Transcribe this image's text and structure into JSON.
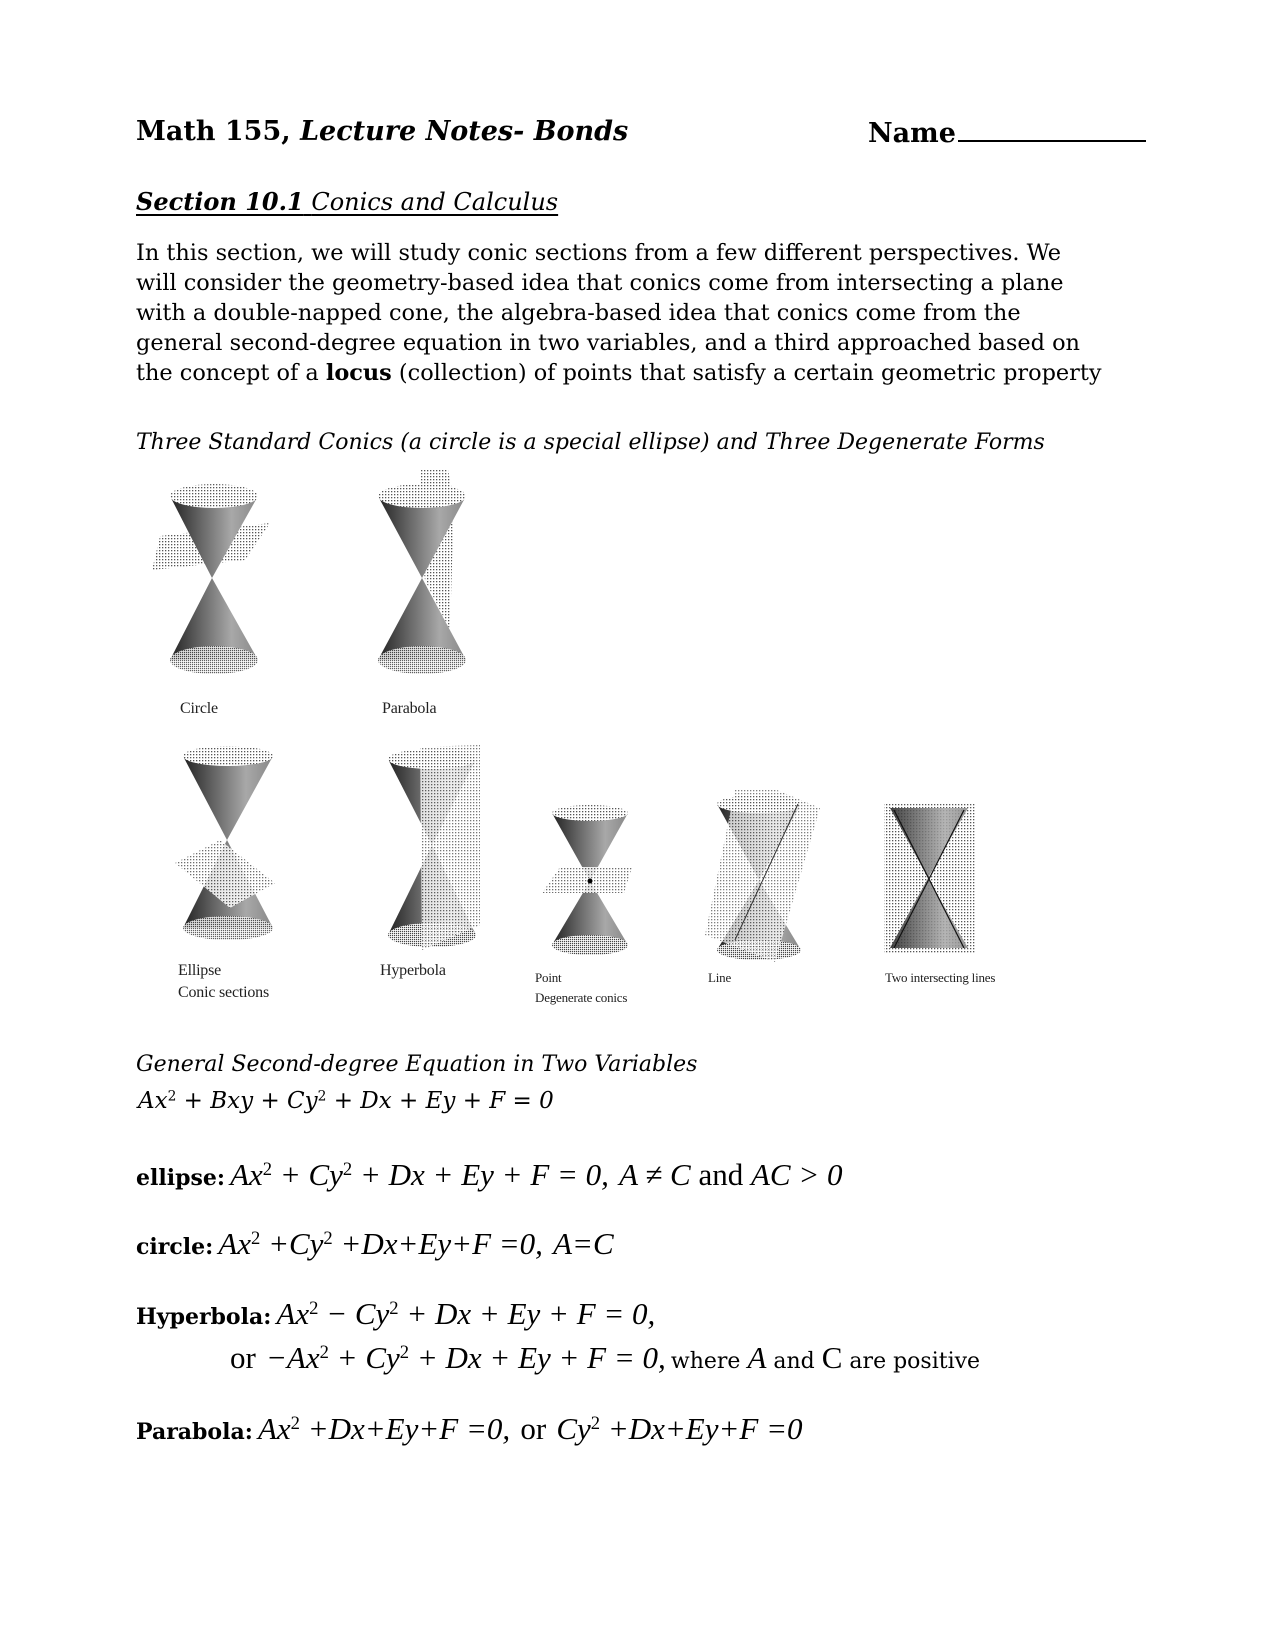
{
  "header": {
    "course": "Math 155,",
    "doc_title": "Lecture Notes- Bonds",
    "name_label": "Name"
  },
  "section": {
    "number": "Section 10.1",
    "title": "Conics and Calculus"
  },
  "intro": {
    "lines": [
      "In this section, we will study conic sections from a few different perspectives. We",
      "will consider the geometry-based idea that conics come from intersecting a plane",
      "with a double-napped cone, the algebra-based idea that conics come from the",
      "general second-degree equation in two variables, and a third approached based on"
    ],
    "last_line_before": "the concept of a ",
    "last_line_bold": "locus",
    "last_line_after": " (collection) of points that satisfy a certain geometric property"
  },
  "figure": {
    "caption": "Three Standard Conics (a circle is a special ellipse) and Three Degenerate Forms",
    "top_row": [
      {
        "label": "Circle",
        "plane": "horizontal"
      },
      {
        "label": "Parabola",
        "plane": "parallel-to-side"
      }
    ],
    "bottom_row": [
      {
        "label": "Ellipse",
        "sublabel": "Conic sections",
        "plane": "tilted"
      },
      {
        "label": "Hyperbola",
        "plane": "vertical"
      },
      {
        "label": "Point",
        "sublabel": "Degenerate conics",
        "plane": "through-vertex-horizontal"
      },
      {
        "label": "Line",
        "plane": "tangent-through-vertex"
      },
      {
        "label": "Two intersecting lines",
        "plane": "vertical-through-vertex"
      }
    ]
  },
  "general": {
    "heading": "General Second-degree Equation in Two Variables",
    "equation_parts": [
      "Ax",
      "2",
      " + Bxy + Cy",
      "2",
      " + Dx + Ey + F = 0"
    ]
  },
  "forms": {
    "ellipse": {
      "label": "ellipse:",
      "eq_a": "Ax",
      "sup1": "2",
      "eq_b": " + Cy",
      "sup2": "2",
      "eq_c": " + Dx + Ey + F = 0,",
      "cond_a": "A ≠ C",
      "cond_and": " and ",
      "cond_b": "AC > 0"
    },
    "circle": {
      "label": "circle:",
      "eq_a": "Ax",
      "sup1": "2",
      "eq_b": " +Cy",
      "sup2": "2",
      "eq_c": " +Dx+Ey+F =0,",
      "cond": "A=C"
    },
    "hyperbola": {
      "label": "Hyperbola:",
      "eq1_a": "Ax",
      "sup1": "2",
      "eq1_b": " − Cy",
      "sup2": "2",
      "eq1_c": " + Dx + Ey + F = 0,",
      "or": "or",
      "eq2_a": "−Ax",
      "sup3": "2",
      "eq2_b": " + Cy",
      "sup4": "2",
      "eq2_c": " + Dx + Ey + F = 0,",
      "note_where": "where ",
      "note_A": "A",
      "note_and": " and ",
      "note_C": "C",
      "note_rest": " are positive"
    },
    "parabola": {
      "label": "Parabola:",
      "eq_a": "Ax",
      "sup1": "2",
      "eq_b": " +Dx+Ey+F =0,",
      "or": "or",
      "eq_c": "Cy",
      "sup2": "2",
      "eq_d": " +Dx+Ey+F =0"
    }
  }
}
